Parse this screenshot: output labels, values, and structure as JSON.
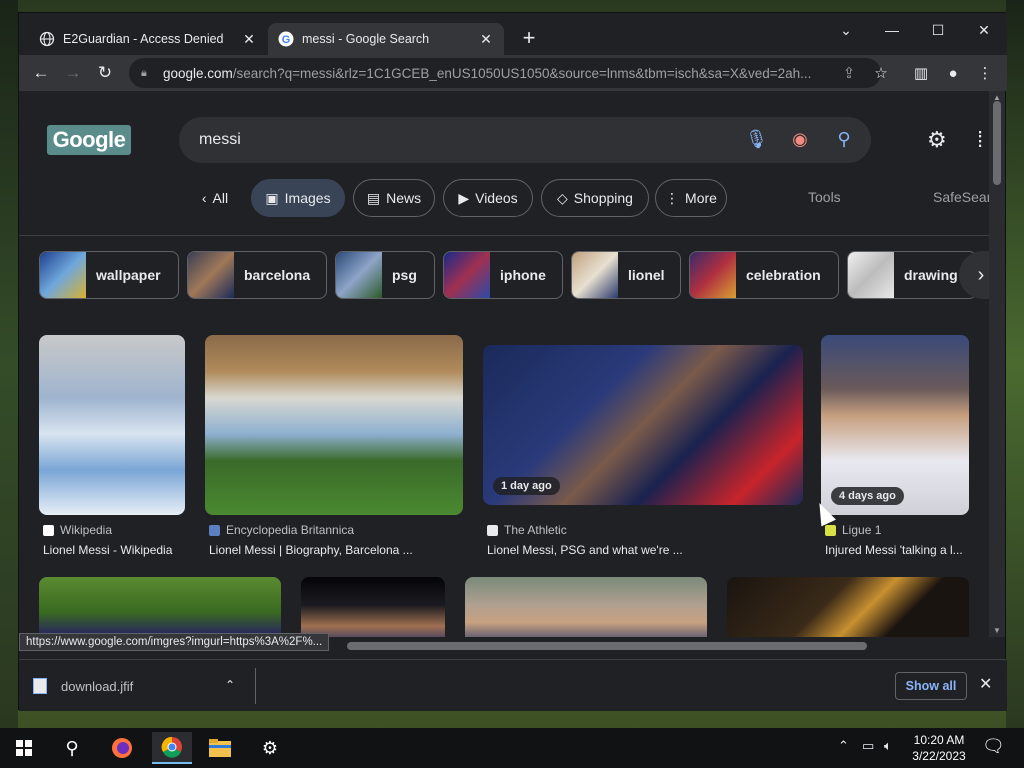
{
  "browser": {
    "tabs": [
      {
        "title": "E2Guardian - Access Denied",
        "active": false
      },
      {
        "title": "messi - Google Search",
        "active": true
      }
    ],
    "url_host": "google.com",
    "url_path": "/search?q=messi&rlz=1C1GCEB_enUS1050US1050&source=lnms&tbm=isch&sa=X&ved=2ah...",
    "window_controls": {
      "minimize": "—",
      "maximize": "☐",
      "close": "✕",
      "tab_search": "⌄"
    }
  },
  "google": {
    "logo_text": "Google",
    "query": "messi",
    "nav_tabs": [
      {
        "label": "All",
        "icon": "‹"
      },
      {
        "label": "Images",
        "icon": "▣"
      },
      {
        "label": "News",
        "icon": "▤"
      },
      {
        "label": "Videos",
        "icon": "▶"
      },
      {
        "label": "Shopping",
        "icon": "◇"
      },
      {
        "label": "More",
        "icon": "⋮"
      }
    ],
    "tools": "Tools",
    "safesearch": "SafeSear",
    "chips": [
      "wallpaper",
      "barcelona",
      "psg",
      "iphone",
      "lionel",
      "celebration",
      "drawing"
    ],
    "results": [
      {
        "source": "Wikipedia",
        "caption": "Lionel Messi - Wikipedia",
        "badge": ""
      },
      {
        "source": "Encyclopedia Britannica",
        "caption": "Lionel Messi | Biography, Barcelona ...",
        "badge": ""
      },
      {
        "source": "The Athletic",
        "caption": "Lionel Messi, PSG and what we're ...",
        "badge": "1 day ago"
      },
      {
        "source": "Ligue 1",
        "caption": "Injured Messi 'talking a l...",
        "badge": "4 days ago"
      }
    ]
  },
  "status_url": "https://www.google.com/imgres?imgurl=https%3A%2F%...",
  "downloads": {
    "file": "download.jfif",
    "show_all": "Show all"
  },
  "taskbar": {
    "time": "10:20 AM",
    "date": "3/22/2023"
  },
  "colors": {
    "accent": "#8ab4f8",
    "page_bg": "#202124",
    "chrome_bg": "#35363a"
  }
}
